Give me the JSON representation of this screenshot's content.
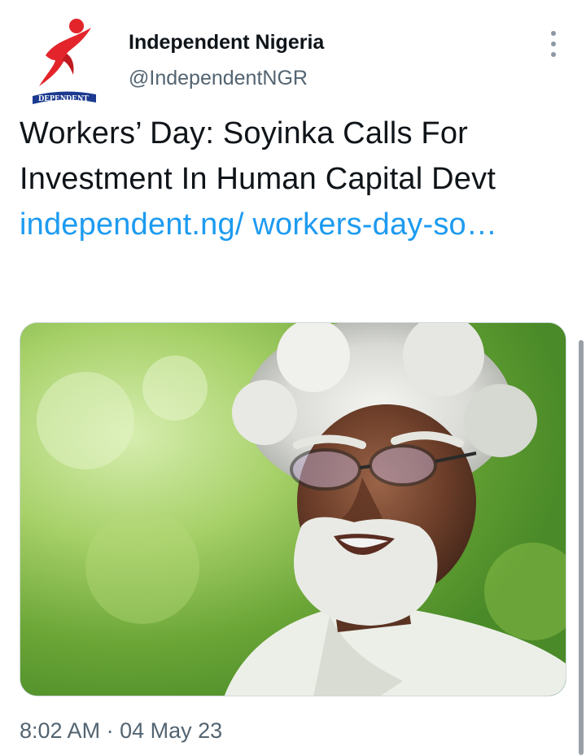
{
  "account": {
    "display_name": "Independent Nigeria",
    "handle": "@IndependentNGR",
    "logo_text": "DEPENDENT",
    "brand_color": "#e3242b",
    "logo_band_color": "#1b3a8f"
  },
  "tweet": {
    "text": "Workers’ Day: Soyinka Calls For Investment In Human Capital Devt ",
    "link_display": "independent.ng/ workers-day-so…",
    "link_color": "#1d9bf0",
    "time": "8:02 AM",
    "separator": "·",
    "date": "04 May 23"
  },
  "media": {
    "subject": "photo of a man with white hair and beard wearing glasses, green background"
  },
  "icons": {
    "more": "more-vertical-icon"
  }
}
